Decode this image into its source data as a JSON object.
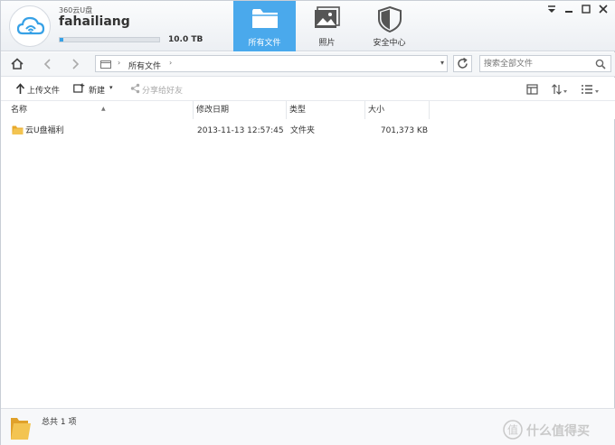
{
  "header": {
    "app_name": "360云U盘",
    "user_name": "fahailiang",
    "quota_label": "10.0 TB",
    "quota_used_fraction": 0.04
  },
  "nav_tabs": [
    {
      "label": "所有文件",
      "icon": "folder-icon",
      "active": true
    },
    {
      "label": "照片",
      "icon": "photos-icon",
      "active": false
    },
    {
      "label": "安全中心",
      "icon": "shield-icon",
      "active": false
    }
  ],
  "window_controls": [
    "dropdown-arrow-icon",
    "minimize-icon",
    "maximize-icon",
    "close-icon"
  ],
  "address": {
    "breadcrumb": "所有文件",
    "search_placeholder": "搜索全部文件"
  },
  "toolbar": {
    "upload_label": "上传文件",
    "new_label": "新建",
    "share_label": "分享给好友"
  },
  "columns": [
    "名称",
    "修改日期",
    "类型",
    "大小"
  ],
  "rows": [
    {
      "name": "云U盘福利",
      "modified": "2013-11-13 12:57:45",
      "type": "文件夹",
      "size": "701,373 KB"
    }
  ],
  "status": {
    "count_label": "总共 1 项"
  },
  "watermark": {
    "text": "什么值得买",
    "logo_char": "值"
  },
  "colors": {
    "accent": "#4aa9ec",
    "quota_fill": "#37a1e6",
    "folder": "#f0b93a"
  }
}
